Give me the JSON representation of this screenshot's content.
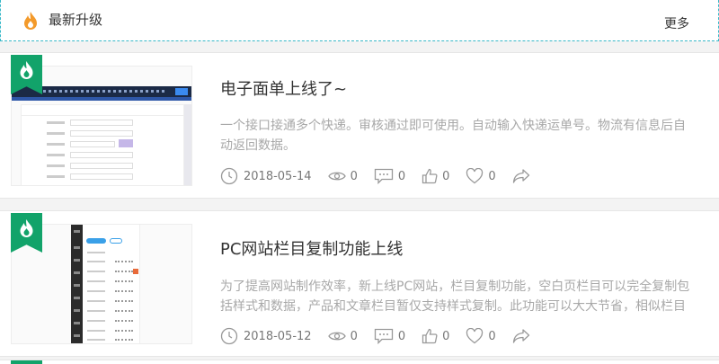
{
  "header": {
    "title": "最新升级",
    "more": "更多"
  },
  "posts": [
    {
      "title": "电子面单上线了~",
      "desc": "一个接口接通多个快递。审核通过即可使用。自动输入快递运单号。物流有信息后自动返回数据。",
      "date": "2018-05-14",
      "views": "0",
      "comments": "0",
      "likes": "0",
      "favorites": "0"
    },
    {
      "title": "PC网站栏目复制功能上线",
      "desc": "为了提高网站制作效率，新上线PC网站，栏目复制功能，空白页栏目可以完全复制包括样式和数据，产品和文章栏目暂仅支持样式复制。此功能可以大大节省，相似栏目",
      "date": "2018-05-12",
      "views": "0",
      "comments": "0",
      "likes": "0",
      "favorites": "0"
    }
  ],
  "colors": {
    "accent": "#12a36a",
    "header_flame": "#f39a2b",
    "dashed_border": "#38b8c8"
  },
  "icons": [
    "flame-icon",
    "clock-icon",
    "eye-icon",
    "comment-icon",
    "thumbs-up-icon",
    "heart-icon",
    "share-icon"
  ]
}
